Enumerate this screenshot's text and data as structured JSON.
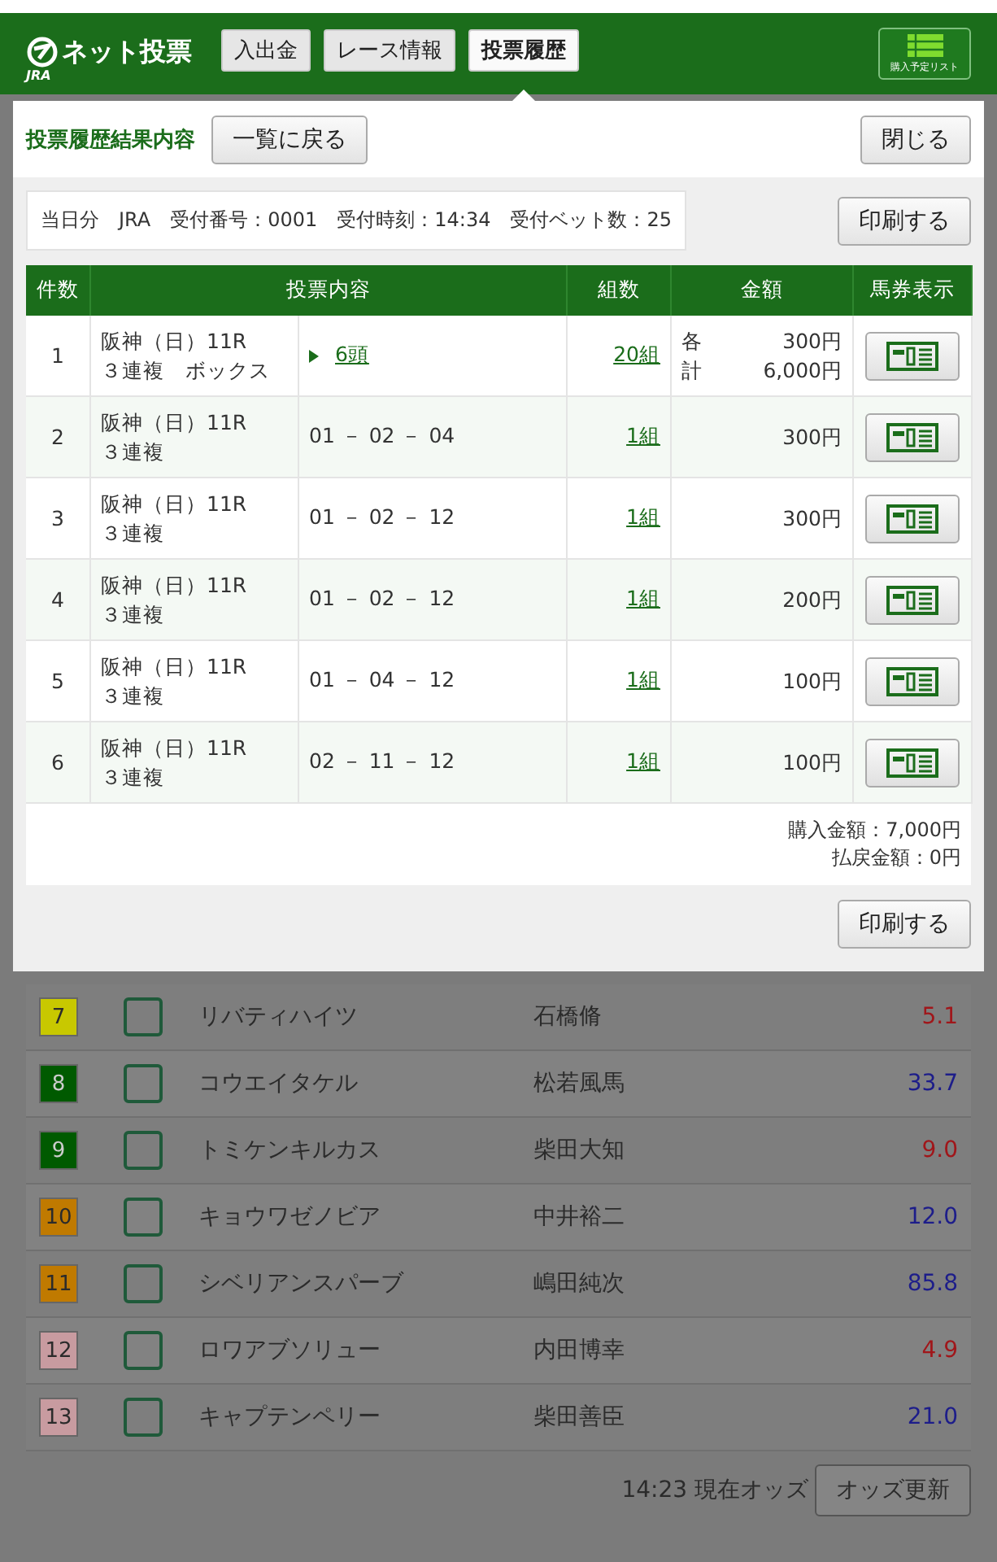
{
  "header": {
    "logo_text": "ネット投票",
    "logo_sub": "JRA",
    "tabs": [
      {
        "label": "入出金",
        "selected": false
      },
      {
        "label": "レース情報",
        "selected": false
      },
      {
        "label": "投票履歴",
        "selected": true
      }
    ],
    "list_button": "購入予定リスト"
  },
  "dialog": {
    "title": "投票履歴結果内容",
    "back_button": "一覧に戻る",
    "close_button": "閉じる",
    "info": "当日分　JRA　受付番号：0001　受付時刻：14:34　受付ベット数：25",
    "print_button": "印刷する",
    "table": {
      "columns": [
        "件数",
        "投票内容",
        "組数",
        "金額",
        "馬券表示"
      ],
      "rows": [
        {
          "no": "1",
          "race": "阪神（日）11R",
          "bet_type": "３連複　ボックス",
          "kind": "box",
          "selection": "6頭",
          "combos": "20組",
          "amount_labels": [
            "各",
            "計"
          ],
          "amounts": [
            "300円",
            "6,000円"
          ]
        },
        {
          "no": "2",
          "race": "阪神（日）11R",
          "bet_type": "３連複",
          "kind": "plain",
          "selection": "01 － 02 － 04",
          "combos": "1組",
          "amounts": [
            "300円"
          ]
        },
        {
          "no": "3",
          "race": "阪神（日）11R",
          "bet_type": "３連複",
          "kind": "plain",
          "selection": "01 － 02 － 12",
          "combos": "1組",
          "amounts": [
            "300円"
          ]
        },
        {
          "no": "4",
          "race": "阪神（日）11R",
          "bet_type": "３連複",
          "kind": "plain",
          "selection": "01 － 02 － 12",
          "combos": "1組",
          "amounts": [
            "200円"
          ]
        },
        {
          "no": "5",
          "race": "阪神（日）11R",
          "bet_type": "３連複",
          "kind": "plain",
          "selection": "01 － 04 － 12",
          "combos": "1組",
          "amounts": [
            "100円"
          ]
        },
        {
          "no": "6",
          "race": "阪神（日）11R",
          "bet_type": "３連複",
          "kind": "plain",
          "selection": "02 － 11 － 12",
          "combos": "1組",
          "amounts": [
            "100円"
          ]
        }
      ]
    },
    "totals": [
      "購入金額：7,000円",
      "払戻金額：0円"
    ],
    "print_button_bottom": "印刷する"
  },
  "runners": [
    {
      "number": "7",
      "color": "#c8c800",
      "checked": false,
      "horse": "リバティハイツ",
      "jockey": "石橋脩",
      "odds": {
        "text": "5.1",
        "color": "#a0161a"
      }
    },
    {
      "number": "8",
      "color": "#005a00",
      "checked": false,
      "horse": "コウエイタケル",
      "jockey": "松若風馬",
      "odds": {
        "text": "33.7",
        "color": "#1d1d8a"
      }
    },
    {
      "number": "9",
      "color": "#005a00",
      "checked": false,
      "horse": "トミケンキルカス",
      "jockey": "柴田大知",
      "odds": {
        "text": "9.0",
        "color": "#a0161a"
      }
    },
    {
      "number": "10",
      "color": "#c07a00",
      "checked": false,
      "horse": "キョウワゼノビア",
      "jockey": "中井裕二",
      "odds": {
        "text": "12.0",
        "color": "#1d1d8a"
      }
    },
    {
      "number": "11",
      "color": "#c07a00",
      "checked": false,
      "horse": "シベリアンスパーブ",
      "jockey": "嶋田純次",
      "odds": {
        "text": "85.8",
        "color": "#1d1d8a"
      }
    },
    {
      "number": "12",
      "color": "#c89ba0",
      "checked": false,
      "horse": "ロワアブソリュー",
      "jockey": "内田博幸",
      "odds": {
        "text": "4.9",
        "color": "#a0161a"
      }
    },
    {
      "number": "13",
      "color": "#c89ba0",
      "checked": false,
      "horse": "キャプテンペリー",
      "jockey": "柴田善臣",
      "odds": {
        "text": "21.0",
        "color": "#1d1d8a"
      }
    }
  ],
  "odds_bar": {
    "time": "14:23 現在オッズ",
    "update_button": "オッズ更新"
  }
}
